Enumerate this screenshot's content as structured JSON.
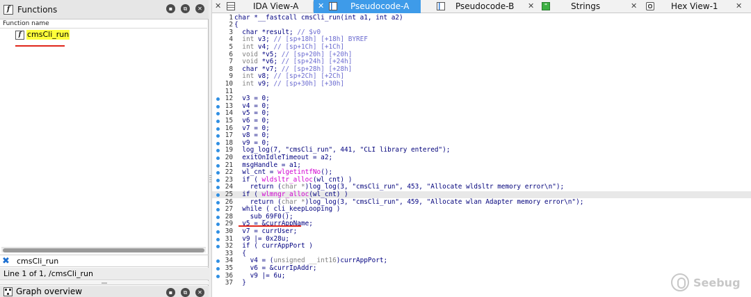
{
  "functions_pane": {
    "title": "Functions",
    "icon": "function-icon",
    "column_header": "Function name",
    "items": [
      {
        "name": "cmsCli_run",
        "highlighted": true
      }
    ],
    "filter_text": "cmsCli_run",
    "status": "Line 1 of 1, /cmsCli_run"
  },
  "graph_pane": {
    "title": "Graph overview"
  },
  "tabs": [
    {
      "label": "IDA View-A",
      "icon": "ida-view-icon",
      "active": false
    },
    {
      "label": "Pseudocode-A",
      "icon": "pseudocode-icon",
      "active": true
    },
    {
      "label": "Pseudocode-B",
      "icon": "pseudocode-icon",
      "active": false
    },
    {
      "label": "Strings",
      "icon": "strings-icon",
      "active": false
    },
    {
      "label": "Hex View-1",
      "icon": "hex-view-icon",
      "active": false
    }
  ],
  "code": {
    "highlighted_line": 25,
    "lines": [
      {
        "n": "1",
        "dot": false,
        "text": "char *__fastcall cmsCli_run(int a1, int a2)"
      },
      {
        "n": "2",
        "dot": false,
        "text": "{"
      },
      {
        "n": "3",
        "dot": false,
        "text": "  char *result; // $v0"
      },
      {
        "n": "4",
        "dot": false,
        "text": "  int v3; // [sp+18h] [+18h] BYREF"
      },
      {
        "n": "5",
        "dot": false,
        "text": "  int v4; // [sp+1Ch] [+1Ch]"
      },
      {
        "n": "6",
        "dot": false,
        "text": "  void *v5; // [sp+20h] [+20h]"
      },
      {
        "n": "7",
        "dot": false,
        "text": "  void *v6; // [sp+24h] [+24h]"
      },
      {
        "n": "8",
        "dot": false,
        "text": "  char *v7; // [sp+28h] [+28h]"
      },
      {
        "n": "9",
        "dot": false,
        "text": "  int v8; // [sp+2Ch] [+2Ch]"
      },
      {
        "n": "10",
        "dot": false,
        "text": "  int v9; // [sp+30h] [+30h]"
      },
      {
        "n": "11",
        "dot": false,
        "text": ""
      },
      {
        "n": "12",
        "dot": true,
        "text": "  v3 = 0;"
      },
      {
        "n": "13",
        "dot": true,
        "text": "  v4 = 0;"
      },
      {
        "n": "14",
        "dot": true,
        "text": "  v5 = 0;"
      },
      {
        "n": "15",
        "dot": true,
        "text": "  v6 = 0;"
      },
      {
        "n": "16",
        "dot": true,
        "text": "  v7 = 0;"
      },
      {
        "n": "17",
        "dot": true,
        "text": "  v8 = 0;"
      },
      {
        "n": "18",
        "dot": true,
        "text": "  v9 = 0;"
      },
      {
        "n": "19",
        "dot": true,
        "text": "  log_log(7, \"cmsCli_run\", 441, \"CLI library entered\");"
      },
      {
        "n": "20",
        "dot": true,
        "text": "  exitOnIdleTimeout = a2;"
      },
      {
        "n": "21",
        "dot": true,
        "text": "  msgHandle = a1;"
      },
      {
        "n": "22",
        "dot": true,
        "text": "  wl_cnt = wlgetintfNo();"
      },
      {
        "n": "23",
        "dot": true,
        "text": "  if ( wldsltr_alloc(wl_cnt) )"
      },
      {
        "n": "24",
        "dot": true,
        "text": "    return (char *)log_log(3, \"cmsCli_run\", 453, \"Allocate wldsltr memory error\\n\");"
      },
      {
        "n": "25",
        "dot": true,
        "text": "  if ( wlmngr_alloc(wl_cnt) )"
      },
      {
        "n": "26",
        "dot": true,
        "text": "    return (char *)log_log(3, \"cmsCli_run\", 459, \"Allocate wlan Adapter memory error\\n\");"
      },
      {
        "n": "27",
        "dot": true,
        "text": "  while ( cli_keepLooping )"
      },
      {
        "n": "28",
        "dot": true,
        "text": "    sub_69F0();"
      },
      {
        "n": "29",
        "dot": true,
        "text": "  v5 = &currAppName;"
      },
      {
        "n": "30",
        "dot": true,
        "text": "  v7 = currUser;"
      },
      {
        "n": "31",
        "dot": true,
        "text": "  v9 |= 0x28u;"
      },
      {
        "n": "32",
        "dot": true,
        "text": "  if ( currAppPort )"
      },
      {
        "n": "33",
        "dot": false,
        "text": "  {"
      },
      {
        "n": "34",
        "dot": true,
        "text": "    v4 = (unsigned __int16)currAppPort;"
      },
      {
        "n": "35",
        "dot": true,
        "text": "    v6 = &currIpAddr;"
      },
      {
        "n": "36",
        "dot": true,
        "text": "    v9 |= 6u;"
      },
      {
        "n": "37",
        "dot": false,
        "text": "  }"
      }
    ]
  },
  "watermark": {
    "text": "Seebug"
  },
  "colors": {
    "active_tab": "#3e9be9",
    "highlight": "#ffff3a",
    "annotation_red": "#e0261b",
    "breakpoint_dot": "#2f8fe3"
  }
}
